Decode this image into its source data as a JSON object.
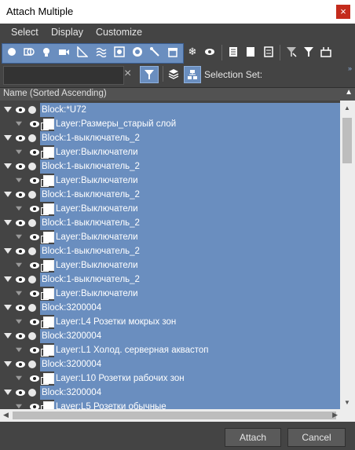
{
  "window": {
    "title": "Attach Multiple",
    "close_glyph": "×"
  },
  "menu": {
    "items": [
      "Select",
      "Display",
      "Customize"
    ]
  },
  "toolbar": {
    "selection_set_label": "Selection Set:"
  },
  "search": {
    "placeholder": "",
    "clear_glyph": "×"
  },
  "list": {
    "column_header": "Name (Sorted Ascending)",
    "rows": [
      {
        "type": "block",
        "label": "Block:*U72"
      },
      {
        "type": "layer",
        "label": "Layer:Размеры_старый слой"
      },
      {
        "type": "block",
        "label": "Block:1-выключатель_2"
      },
      {
        "type": "layer",
        "label": "Layer:Выключатели"
      },
      {
        "type": "block",
        "label": "Block:1-выключатель_2"
      },
      {
        "type": "layer",
        "label": "Layer:Выключатели"
      },
      {
        "type": "block",
        "label": "Block:1-выключатель_2"
      },
      {
        "type": "layer",
        "label": "Layer:Выключатели"
      },
      {
        "type": "block",
        "label": "Block:1-выключатель_2"
      },
      {
        "type": "layer",
        "label": "Layer:Выключатели"
      },
      {
        "type": "block",
        "label": "Block:1-выключатель_2"
      },
      {
        "type": "layer",
        "label": "Layer:Выключатели"
      },
      {
        "type": "block",
        "label": "Block:1-выключатель_2"
      },
      {
        "type": "layer",
        "label": "Layer:Выключатели"
      },
      {
        "type": "block",
        "label": "Block:3200004"
      },
      {
        "type": "layer",
        "label": "Layer:L4 Розетки мокрых зон"
      },
      {
        "type": "block",
        "label": "Block:3200004"
      },
      {
        "type": "layer",
        "label": "Layer:L1 Холод. серверная аквастоп"
      },
      {
        "type": "block",
        "label": "Block:3200004"
      },
      {
        "type": "layer",
        "label": "Layer:L10 Розетки рабочих зон"
      },
      {
        "type": "block",
        "label": "Block:3200004"
      },
      {
        "type": "layer",
        "label": "Layer:L5 Розетки обычные"
      }
    ]
  },
  "buttons": {
    "attach": "Attach",
    "cancel": "Cancel"
  },
  "colors": {
    "selection": "#6a8ebf",
    "panel": "#444444",
    "close": "#c42b1c"
  }
}
